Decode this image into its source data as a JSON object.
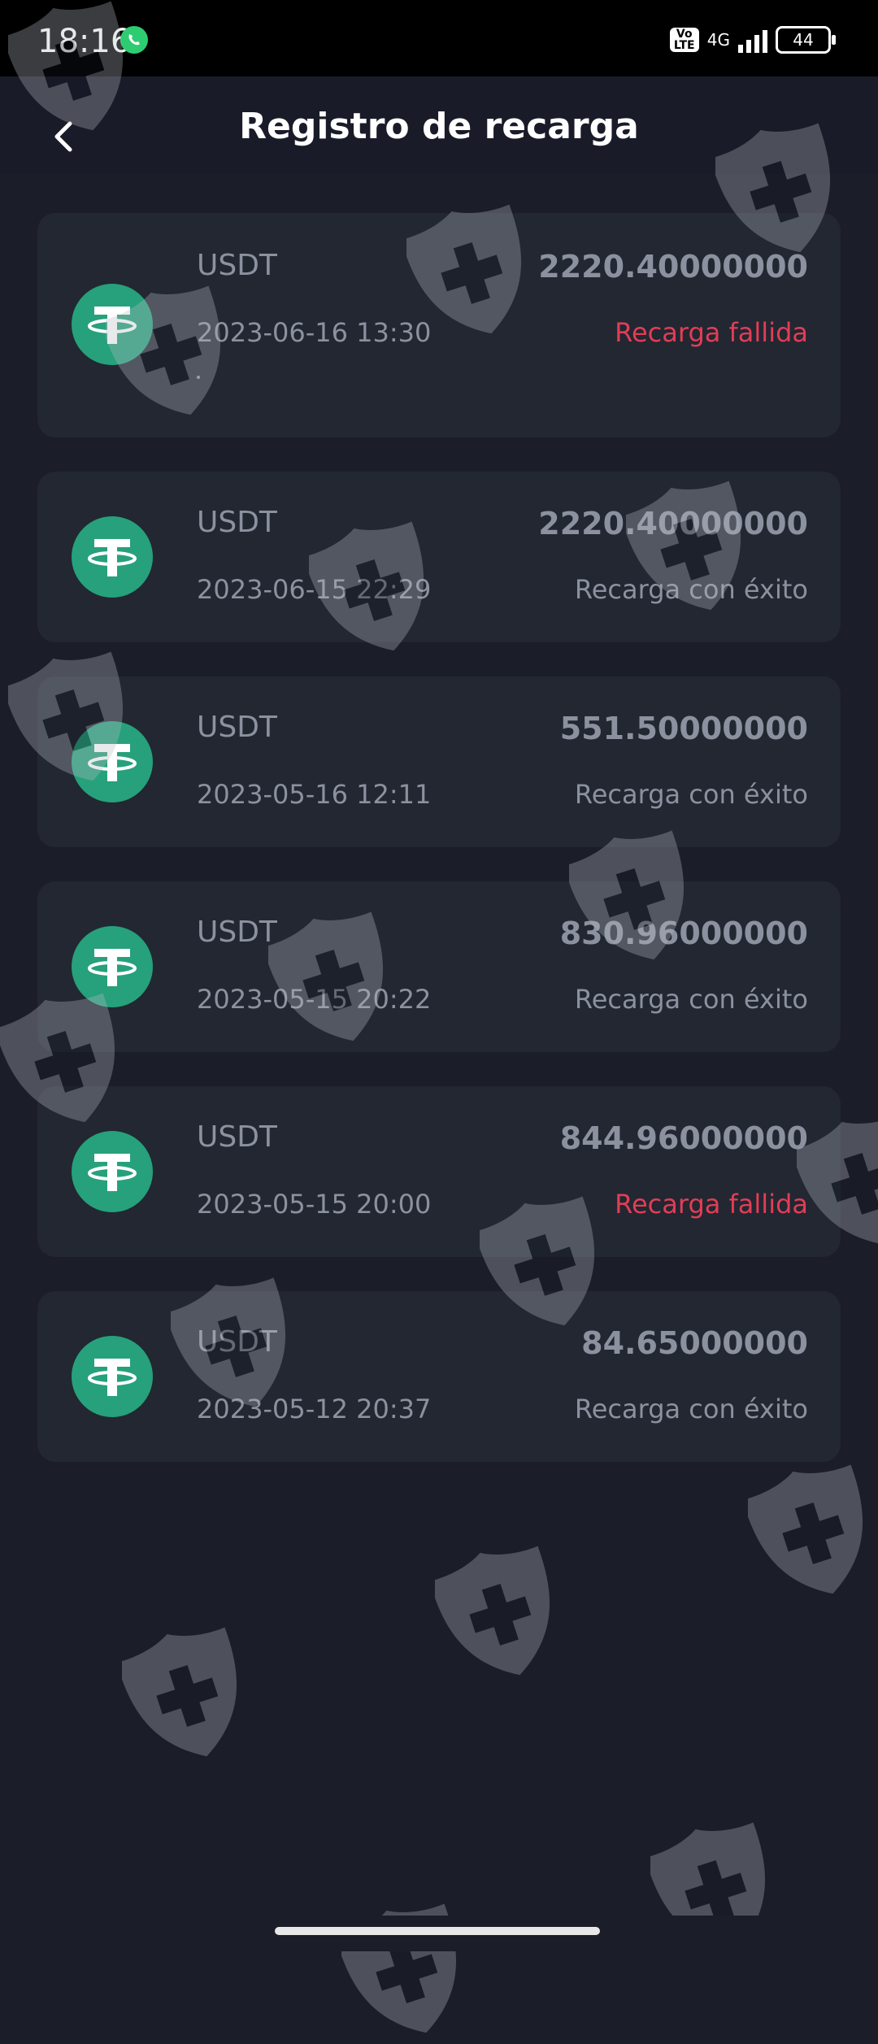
{
  "status_bar": {
    "time": "18:16",
    "network": "4G",
    "volte_top": "Vo",
    "volte_bottom": "LTE",
    "battery": "44"
  },
  "header": {
    "title": "Registro de recarga"
  },
  "records": [
    {
      "asset": "USDT",
      "amount": "2220.40000000",
      "datetime": "2023-06-16 13:30",
      "status": "Recarga fallida",
      "status_type": "failed"
    },
    {
      "asset": "USDT",
      "amount": "2220.40000000",
      "datetime": "2023-06-15 22:29",
      "status": "Recarga con éxito",
      "status_type": "success"
    },
    {
      "asset": "USDT",
      "amount": "551.50000000",
      "datetime": "2023-05-16 12:11",
      "status": "Recarga con éxito",
      "status_type": "success"
    },
    {
      "asset": "USDT",
      "amount": "830.96000000",
      "datetime": "2023-05-15 20:22",
      "status": "Recarga con éxito",
      "status_type": "success"
    },
    {
      "asset": "USDT",
      "amount": "844.96000000",
      "datetime": "2023-05-15 20:00",
      "status": "Recarga fallida",
      "status_type": "failed"
    },
    {
      "asset": "USDT",
      "amount": "84.65000000",
      "datetime": "2023-05-12 20:37",
      "status": "Recarga con éxito",
      "status_type": "success"
    }
  ],
  "icons": {
    "back": "chevron-left-icon",
    "coin": "tether-usdt-icon",
    "watermark": "shield-cross-icon"
  },
  "colors": {
    "background": "#1b1d29",
    "card": "#222732",
    "failed": "#e23d55",
    "muted_text": "#8b919e",
    "tether_green": "#26a17b"
  }
}
